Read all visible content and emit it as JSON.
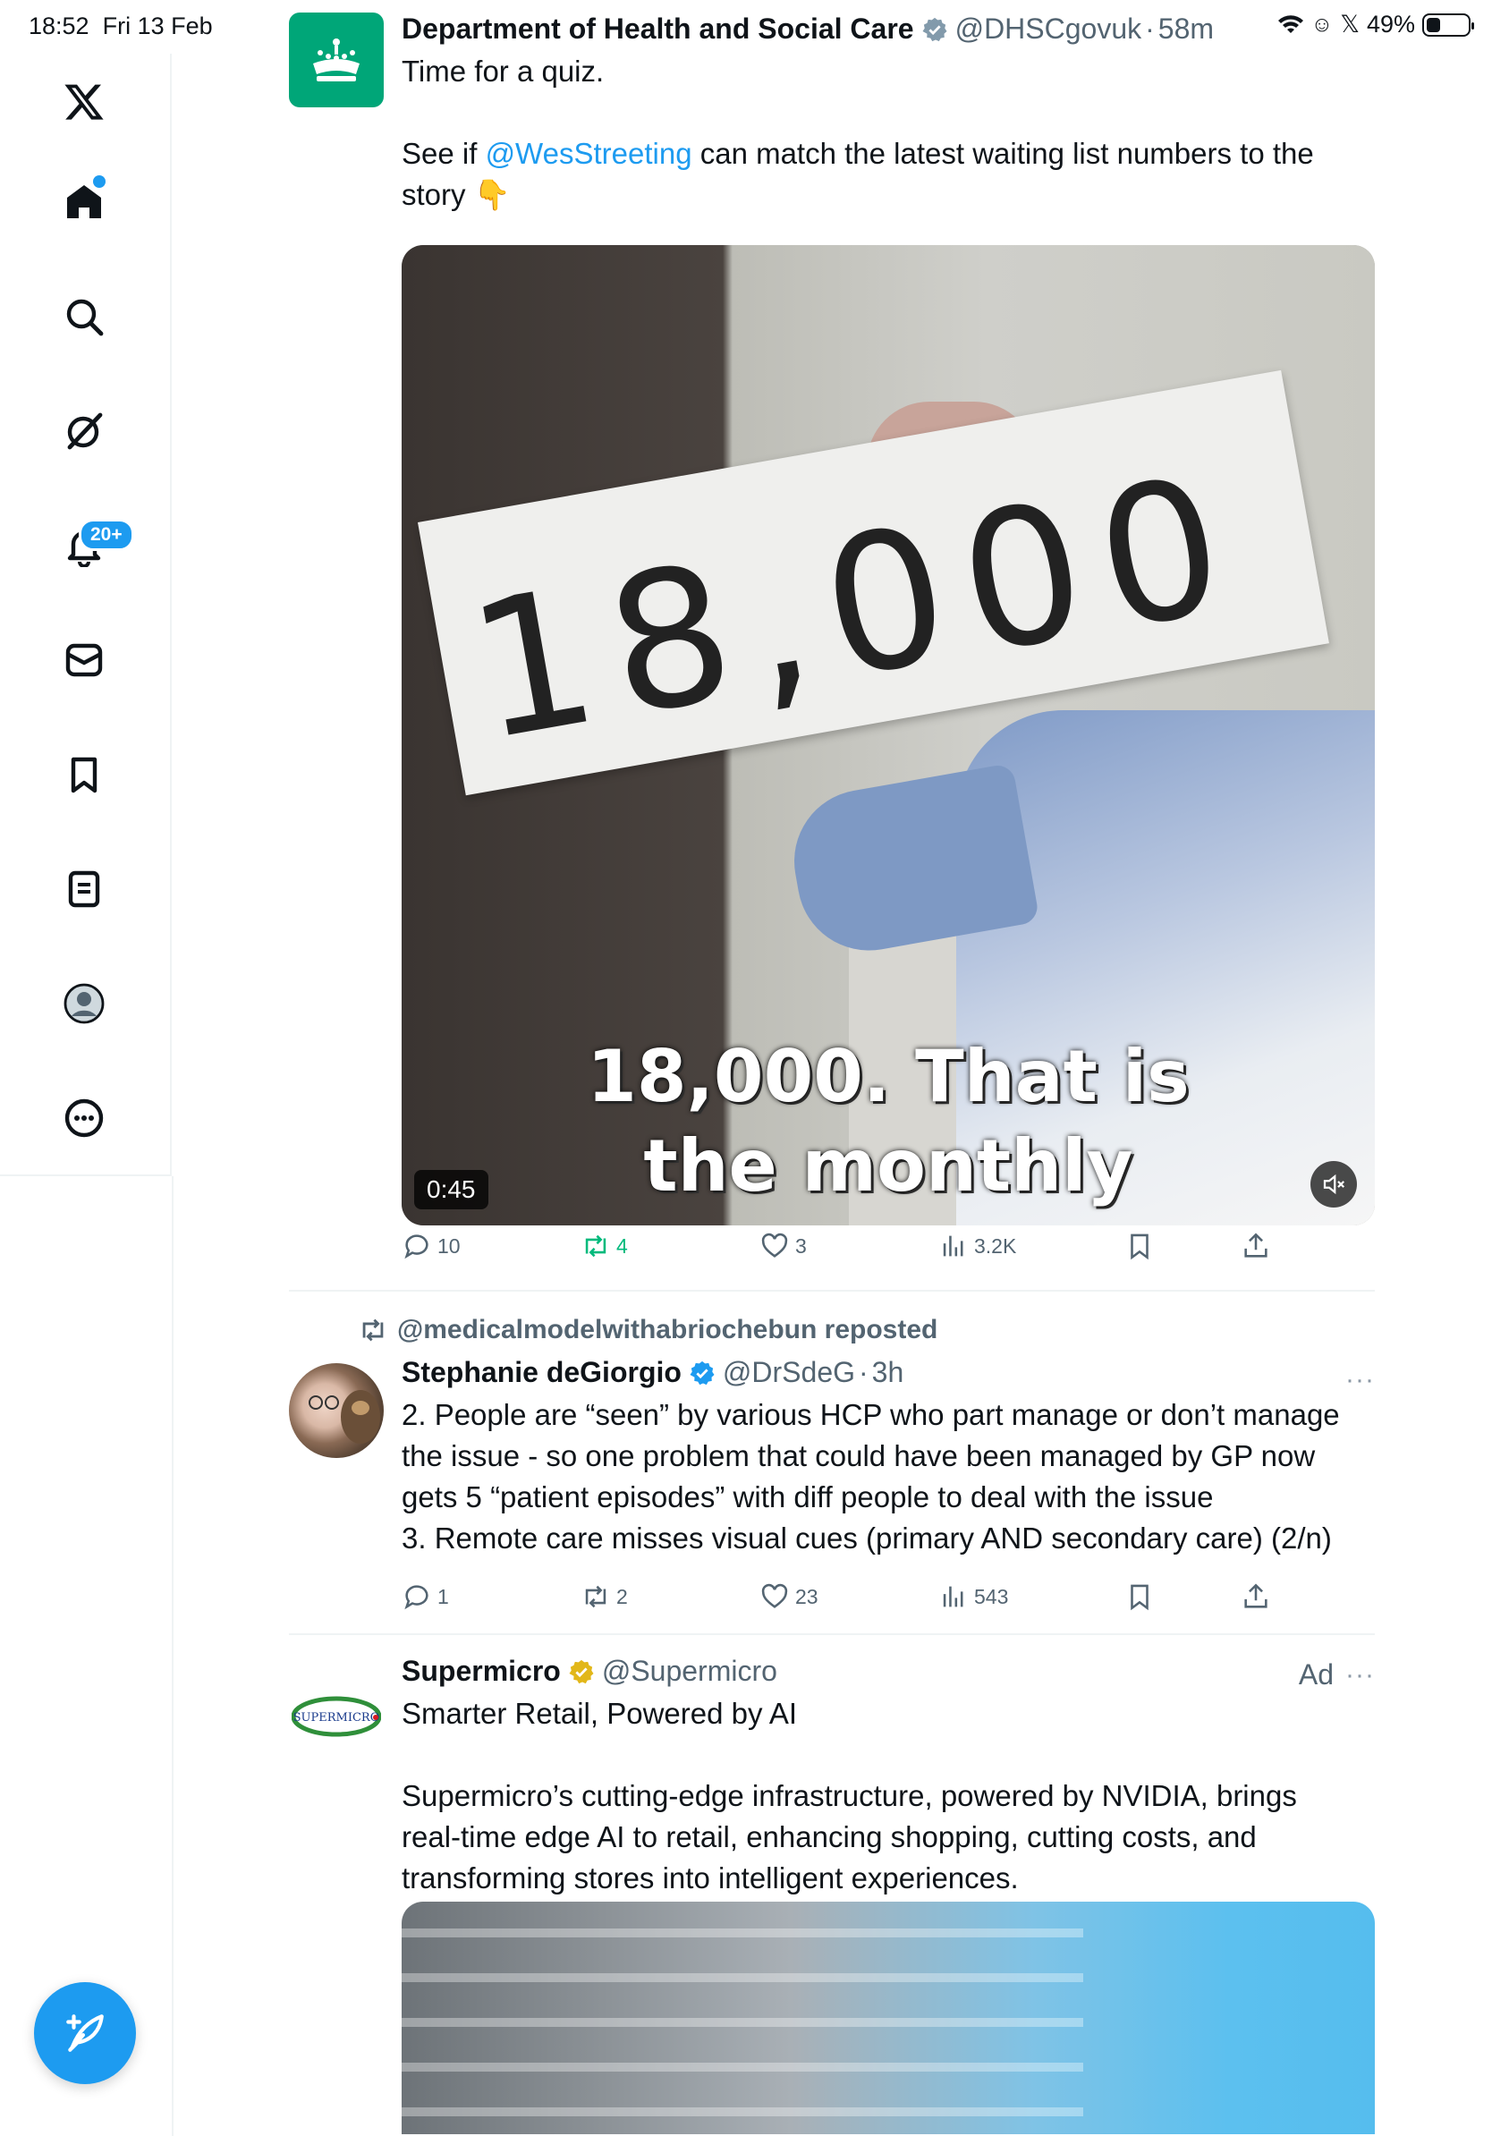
{
  "status_bar": {
    "time": "18:52",
    "date": "Fri 13 Feb",
    "battery": "49%"
  },
  "sidebar": {
    "notifications_badge": "20+"
  },
  "tweets": [
    {
      "name": "Department of Health and Social Care",
      "handle": "@DHSCgovuk",
      "sep": "·",
      "time": "58m",
      "lines": [
        "Time for a quiz.",
        "",
        "See if ",
        "@WesStreeting",
        " can match the latest waiting list numbers to the",
        "story 👇"
      ],
      "video": {
        "card": "18,000",
        "caption_1": "18,000. That is",
        "caption_2": "the monthly",
        "duration": "0:45"
      },
      "stats": {
        "replies": "10",
        "reposts": "4",
        "likes": "3",
        "views": "3.2K"
      }
    },
    {
      "reposted_by": "@medicalmodelwithabriochebun reposted",
      "name": "Stephanie deGiorgio",
      "handle": "@DrSdeG",
      "sep": "·",
      "time": "3h",
      "lines": [
        "2. People are “seen” by various HCP who part manage or don’t manage",
        "the issue - so one problem that could have been managed by GP now",
        "gets 5 “patient episodes” with diff people to deal with the issue",
        "3. Remote care misses visual cues (primary AND secondary care) (2/n)"
      ],
      "stats": {
        "replies": "1",
        "reposts": "2",
        "likes": "23",
        "views": "543"
      }
    },
    {
      "name": "Supermicro",
      "handle": "@Supermicro",
      "ad_label": "Ad",
      "logo_text": "SUPERMICRO",
      "lines": [
        "Smarter Retail, Powered by AI",
        "",
        "Supermicro’s cutting-edge infrastructure, powered by NVIDIA, brings",
        "real-time edge AI to retail, enhancing shopping, cutting costs, and",
        "transforming stores into intelligent experiences."
      ]
    }
  ],
  "more_label": "···",
  "colors": {
    "accent": "#1d9bf0",
    "repost": "#00ba7c",
    "muted": "#536471",
    "gov_green": "#00a678",
    "gold_check": "#e2b719"
  }
}
